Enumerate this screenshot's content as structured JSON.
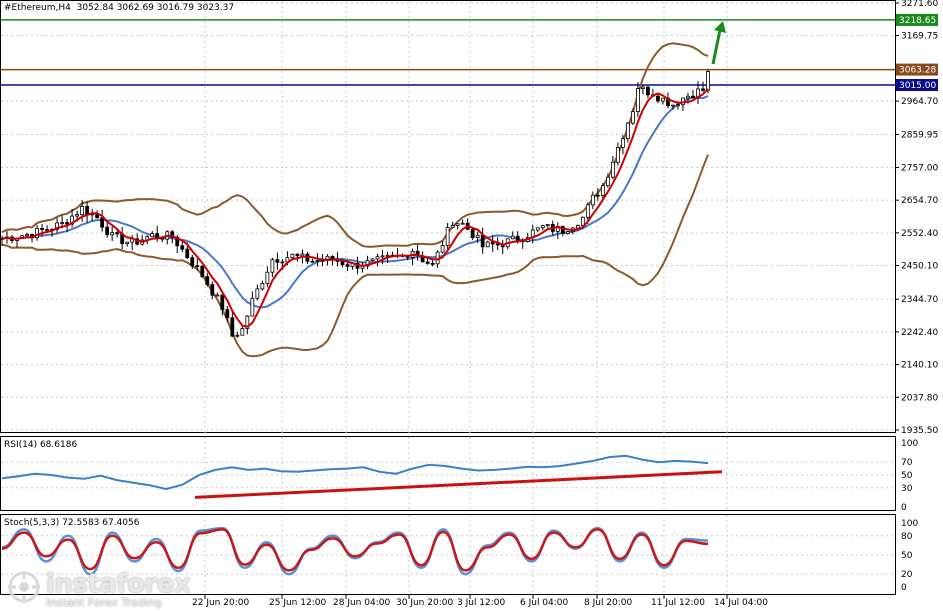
{
  "header": {
    "symbol": "#Ethereum,H4",
    "ohlc": "3052.84 3062.69 3016.79 3023.37"
  },
  "colors": {
    "background": "#ffffff",
    "grid": "#c8c8c8",
    "candle": "#000000",
    "bb": "#8b5a2b",
    "ma_fast": "#cc0000",
    "ma_slow": "#4a78c8",
    "green": "#1a8a1a",
    "brown_level": "#8b4a1e",
    "navy_level": "#0a0a8c",
    "rsi_line": "#3a7fc8",
    "trend_red": "#cc1010",
    "stoch_main": "#5b8fd6",
    "stoch_signal": "#c81818"
  },
  "chart_data": [
    {
      "type": "candlestick",
      "title": "#Ethereum,H4",
      "ylim": [
        1935.5,
        3271.6
      ],
      "y_ticks": [
        "3271.60",
        "3169.75",
        "3063.28",
        "2964.70",
        "2859.95",
        "2757.00",
        "2654.70",
        "2552.40",
        "2450.10",
        "2344.70",
        "2242.40",
        "2140.10",
        "2037.80",
        "1935.50"
      ],
      "x_ticks": [
        "22 Jun 20:00",
        "25 Jun 12:00",
        "28 Jun 04:00",
        "30 Jun 20:00",
        "3 Jul 12:00",
        "6 Jul 04:00",
        "8 Jul 20:00",
        "11 Jul 12:00",
        "14 Jul 04:00"
      ],
      "levels": [
        {
          "label": "3218.65",
          "value": 3218.65,
          "color": "green"
        },
        {
          "label": "3063.28",
          "value": 3063.28,
          "color": "brown"
        },
        {
          "label": "3015.00",
          "value": 3015.0,
          "color": "navy"
        }
      ],
      "annotation": "green arrow pointing up toward 3218.65",
      "price_path": [
        [
          0,
          2535
        ],
        [
          6,
          2550
        ],
        [
          12,
          2580
        ],
        [
          16,
          2630
        ],
        [
          19,
          2600
        ],
        [
          22,
          2540
        ],
        [
          26,
          2520
        ],
        [
          30,
          2545
        ],
        [
          34,
          2540
        ],
        [
          36,
          2500
        ],
        [
          40,
          2420
        ],
        [
          44,
          2320
        ],
        [
          46,
          2230
        ],
        [
          48,
          2250
        ],
        [
          50,
          2340
        ],
        [
          54,
          2470
        ],
        [
          58,
          2480
        ],
        [
          62,
          2465
        ],
        [
          66,
          2470
        ],
        [
          70,
          2450
        ],
        [
          74,
          2460
        ],
        [
          78,
          2475
        ],
        [
          80,
          2480
        ],
        [
          82,
          2500
        ],
        [
          84,
          2470
        ],
        [
          86,
          2450
        ],
        [
          88,
          2520
        ],
        [
          90,
          2590
        ],
        [
          92,
          2580
        ],
        [
          94,
          2550
        ],
        [
          96,
          2510
        ],
        [
          100,
          2520
        ],
        [
          104,
          2540
        ],
        [
          108,
          2570
        ],
        [
          112,
          2560
        ],
        [
          116,
          2600
        ],
        [
          118,
          2660
        ],
        [
          120,
          2700
        ],
        [
          122,
          2780
        ],
        [
          124,
          2860
        ],
        [
          126,
          2940
        ],
        [
          127,
          3010
        ],
        [
          128,
          3000
        ],
        [
          130,
          2990
        ],
        [
          132,
          2970
        ],
        [
          134,
          2955
        ],
        [
          136,
          2975
        ],
        [
          138,
          2990
        ],
        [
          140,
          3000
        ],
        [
          141,
          3050
        ]
      ],
      "bollinger_note": "upper/lower bands and two moving averages drawn around price"
    },
    {
      "type": "line",
      "title": "RSI(14) 68.6186",
      "ylim": [
        0,
        100
      ],
      "y_ticks": [
        "100",
        "70",
        "50",
        "30",
        "0"
      ],
      "values": [
        45,
        48,
        52,
        50,
        46,
        44,
        49,
        42,
        38,
        34,
        28,
        35,
        50,
        58,
        62,
        58,
        60,
        56,
        55,
        57,
        59,
        60,
        62,
        55,
        52,
        60,
        66,
        64,
        60,
        57,
        58,
        60,
        63,
        62,
        64,
        68,
        72,
        78,
        80,
        74,
        70,
        72,
        71,
        68.6
      ],
      "trendline": {
        "from": [
          0,
          15
        ],
        "to": [
          1,
          55
        ]
      }
    },
    {
      "type": "line",
      "title": "Stoch(5,3,3) 72.5583 67.4056",
      "ylim": [
        0,
        100
      ],
      "y_ticks": [
        "100",
        "80",
        "50",
        "20",
        "0"
      ],
      "series": [
        {
          "name": "main",
          "values": [
            62,
            90,
            40,
            80,
            20,
            85,
            40,
            75,
            25,
            88,
            92,
            30,
            70,
            20,
            60,
            80,
            45,
            70,
            85,
            30,
            90,
            20,
            65,
            85,
            40,
            88,
            60,
            92,
            40,
            85,
            30,
            75,
            72.6
          ]
        },
        {
          "name": "signal",
          "values": [
            60,
            85,
            48,
            74,
            28,
            80,
            45,
            70,
            30,
            84,
            90,
            35,
            66,
            26,
            58,
            76,
            48,
            68,
            82,
            34,
            86,
            26,
            62,
            82,
            44,
            85,
            62,
            90,
            44,
            82,
            34,
            72,
            67.4
          ]
        }
      ]
    }
  ],
  "brand": {
    "name": "instaforex",
    "tagline": "Instant Forex Trading"
  }
}
